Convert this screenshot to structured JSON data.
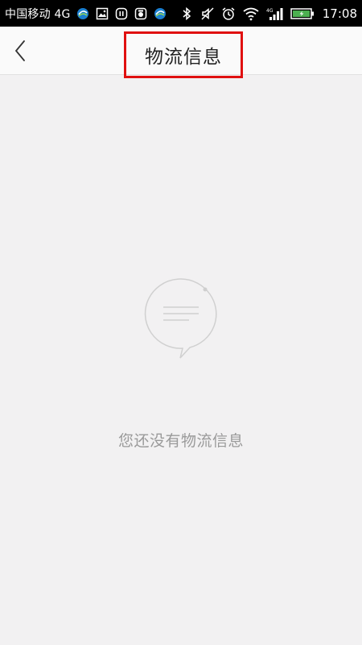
{
  "status_bar": {
    "carrier": "中国移动 4G",
    "network_small_label": "4G",
    "time": "17:08"
  },
  "header": {
    "title": "物流信息"
  },
  "empty_state": {
    "message": "您还没有物流信息"
  },
  "colors": {
    "status_bar_bg": "#000000",
    "header_bg": "#fafafa",
    "page_bg": "#f2f1f2",
    "highlight_box": "#e01010",
    "empty_text": "#9a9a9a",
    "battery_green": "#4caf50"
  },
  "icons": {
    "back": "chevron-left-icon",
    "empty_state": "speech-bubble-icon"
  }
}
